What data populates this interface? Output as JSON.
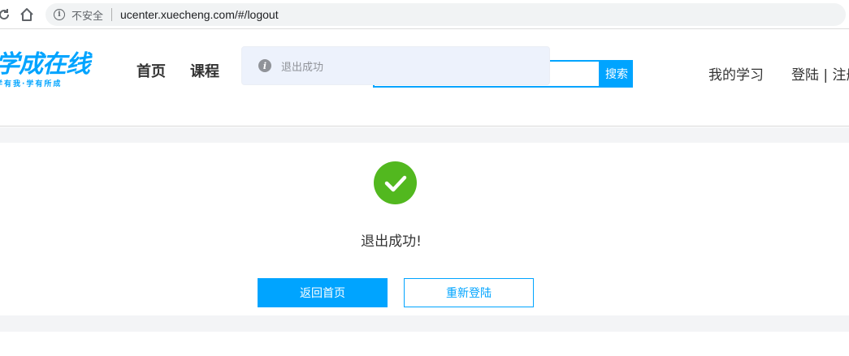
{
  "browser": {
    "security_label": "不安全",
    "url": "ucenter.xuecheng.com/#/logout",
    "icons": [
      "reload-icon",
      "home-icon",
      "info-icon"
    ]
  },
  "header": {
    "logo_text": "学成在线",
    "logo_slogan": "学有我·学有所成",
    "nav": [
      "首页",
      "课程"
    ],
    "search_placeholder": "",
    "search_button": "搜索",
    "my_learning": "我的学习",
    "login": "登陆",
    "divider": "|",
    "register": "注册"
  },
  "toast": {
    "text": "退出成功",
    "icon": "info-icon"
  },
  "content": {
    "icon": "check-circle-icon",
    "message": "退出成功!",
    "home_button": "返回首页",
    "relogin_button": "重新登陆"
  },
  "colors": {
    "brand": "#00a4ff",
    "success": "#52b81f",
    "band": "#f3f4f6"
  }
}
